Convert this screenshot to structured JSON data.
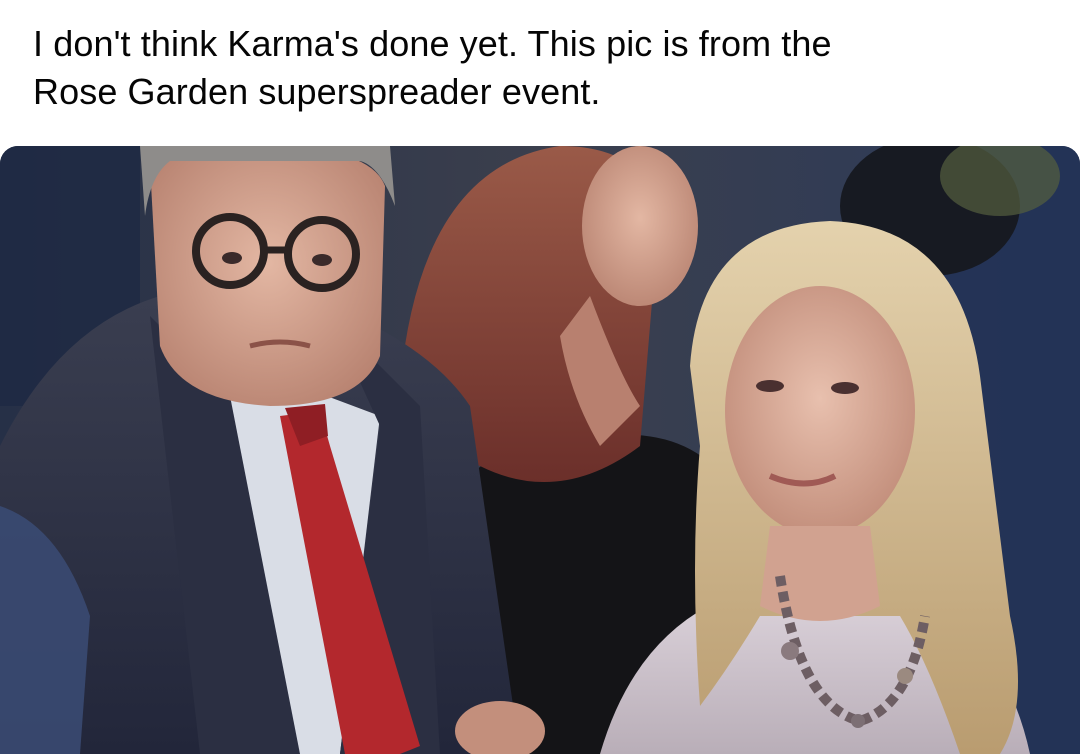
{
  "post": {
    "text_line_1": "I don't think Karma's done yet. This pic is from the",
    "text_line_2": "Rose Garden superspreader event."
  },
  "photo": {
    "subject": "outdoor crowd photo: older man in glasses with dark suit and red tie, woman with reddish-brown hair behind, blonde woman in lavender top with beaded necklace"
  },
  "colors": {
    "text": "#050505",
    "background": "#ffffff",
    "suit": "#2f3345",
    "tie": "#b3282d",
    "blonde_hair": "#d8c49a",
    "lavender_top": "#cfc6cf"
  }
}
